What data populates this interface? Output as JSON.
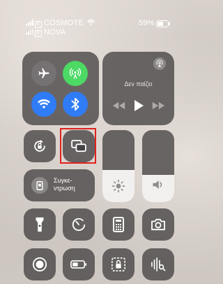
{
  "status_bar": {
    "carrier_primary": "COSMOTE",
    "carrier_secondary": "NOVA",
    "battery_percent": "59%",
    "battery_level": 0.59
  },
  "now_playing": {
    "status_text": "Δεν παίζει"
  },
  "screen_mirroring": {
    "label": "Συγκε-\nντρωση"
  },
  "sliders": {
    "brightness_level": 0.45,
    "volume_level": 0.38
  },
  "colors": {
    "tile_bg": "#46424490",
    "airplane_off": "#ffffff",
    "cellular_on": "#4cd964",
    "wifi_on": "#2f7cf6",
    "bluetooth_on": "#2f7cf6",
    "highlight_box": "#e0211d"
  },
  "icons": [
    "airplane-icon",
    "cellular-icon",
    "wifi-icon",
    "bluetooth-icon",
    "airplay-icon",
    "rewind-icon",
    "play-icon",
    "fast-forward-icon",
    "rotation-lock-icon",
    "screen-mirroring-icon",
    "brightness-icon",
    "volume-icon",
    "focus-icon",
    "flashlight-icon",
    "timer-icon",
    "calculator-icon",
    "camera-icon",
    "screen-record-icon",
    "low-power-icon",
    "guided-access-icon",
    "sound-recognition-icon"
  ]
}
